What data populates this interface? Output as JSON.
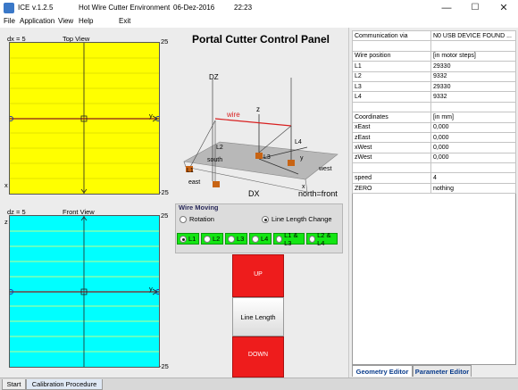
{
  "window": {
    "app": "ICE",
    "version": "v.1.2.5",
    "subtitle": "Hot Wire Cutter Environment",
    "date": "06-Dez-2016",
    "time": "22:23",
    "minimize": "—",
    "maximize": "☐",
    "close": "✕"
  },
  "menu": {
    "file": "File",
    "application": "Application",
    "view": "View",
    "help": "Help",
    "exit": "Exit"
  },
  "top_view": {
    "label_left": "dx = 5",
    "title": "Top View",
    "max": "25",
    "min": "-25",
    "x_axis": "x",
    "y_axis": "y",
    "color": "#ffff00"
  },
  "front_view": {
    "label_left": "dz = 5",
    "title": "Front View",
    "max": "25",
    "min": "-25",
    "z_axis": "z",
    "y_axis": "y",
    "color": "#00ffff"
  },
  "center": {
    "title": "Portal Cutter Control Panel",
    "diagram": {
      "dz": "DZ",
      "z": "z",
      "wire": "wire",
      "south": "south",
      "east": "east",
      "west": "west",
      "north": "north=front",
      "dx": "DX",
      "x": "x",
      "y": "y",
      "l1": "L1",
      "l2": "L2",
      "l3": "L3",
      "l4": "L4"
    },
    "wire_moving": {
      "legend": "Wire Moving",
      "rotation": "Rotation",
      "line_length_change": "Line Length Change",
      "selected": "Line Length Change"
    },
    "line_buttons": [
      "L1",
      "L2",
      "L3",
      "L4",
      "L1 & L3",
      "L2 & L4"
    ],
    "line_selected": "L1",
    "up": "UP",
    "line_length": "Line Length",
    "down": "DOWN"
  },
  "info": {
    "rows": [
      [
        "Communication via",
        "N0 USB DEVICE FOUND ..."
      ],
      [
        "",
        ""
      ],
      [
        "Wire position",
        "[in motor steps]"
      ],
      [
        "L1",
        "29330"
      ],
      [
        "L2",
        "9332"
      ],
      [
        "L3",
        "29330"
      ],
      [
        "L4",
        "9332"
      ],
      [
        "",
        ""
      ],
      [
        "Coordinates",
        "[in mm]"
      ],
      [
        "xEast",
        "0,000"
      ],
      [
        "zEast",
        "0,000"
      ],
      [
        "xWest",
        "0,000"
      ],
      [
        "zWest",
        "0,000"
      ],
      [
        "",
        ""
      ],
      [
        "speed",
        "4"
      ],
      [
        "ZERO",
        "nothing"
      ]
    ]
  },
  "tabs": {
    "geometry_editor": "Geometry Editor",
    "parameter_editor": "Parameter Editor"
  },
  "bottom_tabs": {
    "start": "Start",
    "calibration": "Calibration Procedure"
  }
}
